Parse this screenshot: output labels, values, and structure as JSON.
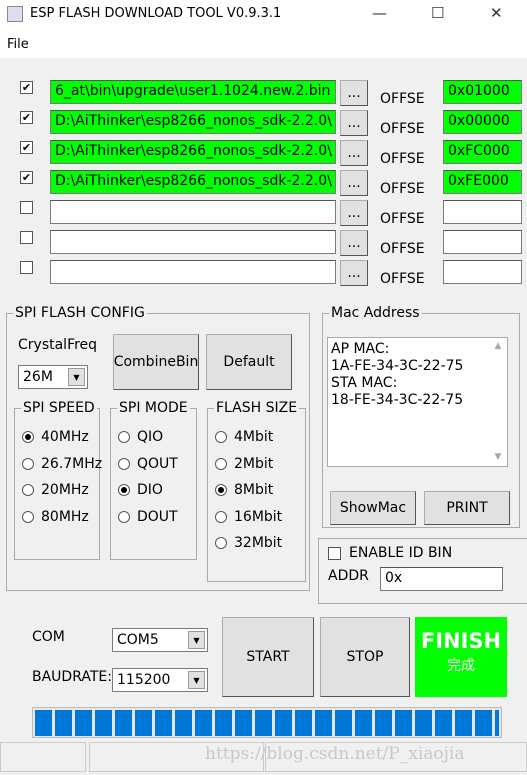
{
  "window": {
    "title": "ESP FLASH DOWNLOAD TOOL V0.9.3.1",
    "minimize": "—",
    "maximize": "☐",
    "close": "✕"
  },
  "menu": {
    "file": "File"
  },
  "files": [
    {
      "checked": true,
      "path": "6_at\\bin\\upgrade\\user1.1024.new.2.bin",
      "offset_label": "OFFSE",
      "offset": "0x01000",
      "ok": true
    },
    {
      "checked": true,
      "path": "D:\\AiThinker\\esp8266_nonos_sdk-2.2.0\\",
      "offset_label": "OFFSE",
      "offset": "0x00000",
      "ok": true
    },
    {
      "checked": true,
      "path": "D:\\AiThinker\\esp8266_nonos_sdk-2.2.0\\",
      "offset_label": "OFFSE",
      "offset": "0xFC000",
      "ok": true
    },
    {
      "checked": true,
      "path": "D:\\AiThinker\\esp8266_nonos_sdk-2.2.0\\",
      "offset_label": "OFFSE",
      "offset": "0xFE000",
      "ok": true
    },
    {
      "checked": false,
      "path": "",
      "offset_label": "OFFSE",
      "offset": "",
      "ok": false
    },
    {
      "checked": false,
      "path": "",
      "offset_label": "OFFSE",
      "offset": "",
      "ok": false
    },
    {
      "checked": false,
      "path": "",
      "offset_label": "OFFSE",
      "offset": "",
      "ok": false
    }
  ],
  "browse_label": "...",
  "spi": {
    "title": "SPI FLASH CONFIG",
    "crystal_label": "CrystalFreq",
    "crystal_value": "26M",
    "combine": "CombineBin",
    "default": "Default",
    "speed": {
      "title": "SPI SPEED",
      "options": [
        "40MHz",
        "26.7MHz",
        "20MHz",
        "80MHz"
      ],
      "selected": 0
    },
    "mode": {
      "title": "SPI MODE",
      "options": [
        "QIO",
        "QOUT",
        "DIO",
        "DOUT"
      ],
      "selected": 2
    },
    "size": {
      "title": "FLASH SIZE",
      "options": [
        "4Mbit",
        "2Mbit",
        "8Mbit",
        "16Mbit",
        "32Mbit"
      ],
      "selected": 2
    }
  },
  "mac": {
    "title": "Mac Address",
    "lines": [
      "AP MAC:",
      "1A-FE-34-3C-22-75",
      "STA MAC:",
      "18-FE-34-3C-22-75"
    ],
    "showmac": "ShowMac",
    "print": "PRINT"
  },
  "idbin": {
    "label": "ENABLE ID BIN",
    "addr_label": "ADDR",
    "addr": "0x"
  },
  "com": {
    "label": "COM",
    "value": "COM5",
    "baud_label": "BAUDRATE:",
    "baud": "115200"
  },
  "actions": {
    "start": "START",
    "stop": "STOP",
    "finish": "FINISH",
    "finish_sub": "完成",
    "finish_color": "#00ff00"
  },
  "progress": {
    "percent": 100,
    "color": "#0078d7"
  },
  "watermark": "https://blog.csdn.net/P_xiaojia"
}
